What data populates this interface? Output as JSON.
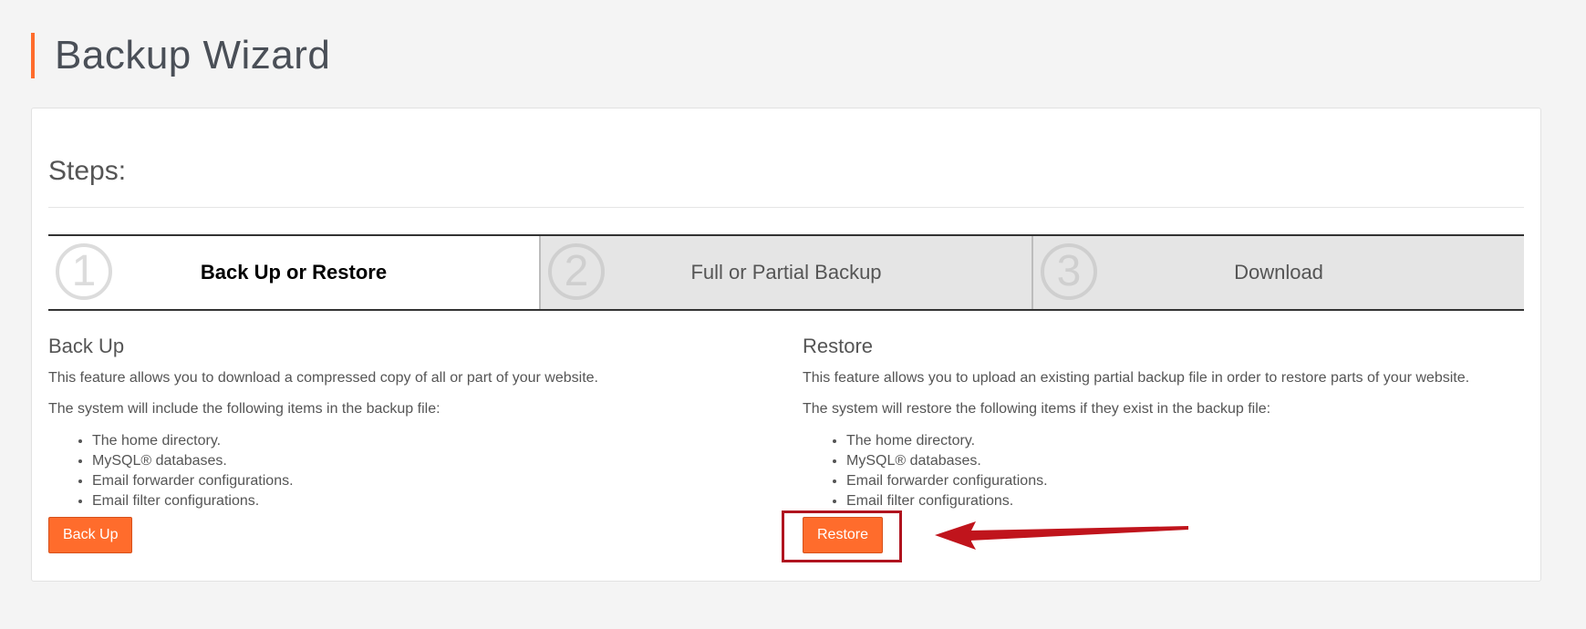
{
  "page": {
    "title": "Backup Wizard"
  },
  "panel": {
    "steps_title": "Steps:"
  },
  "wizard": {
    "steps": [
      {
        "number": "1",
        "label": "Back Up or Restore",
        "state": "active"
      },
      {
        "number": "2",
        "label": "Full or Partial Backup",
        "state": "inactive"
      },
      {
        "number": "3",
        "label": "Download",
        "state": "inactive"
      }
    ]
  },
  "backup": {
    "heading": "Back Up",
    "description": "This feature allows you to download a compressed copy of all or part of your website.",
    "includes_intro": "The system will include the following items in the backup file:",
    "items": [
      "The home directory.",
      "MySQL® databases.",
      "Email forwarder configurations.",
      "Email filter configurations."
    ],
    "button_label": "Back Up"
  },
  "restore": {
    "heading": "Restore",
    "description": "This feature allows you to upload an existing partial backup file in order to restore parts of your website.",
    "includes_intro": "The system will restore the following items if they exist in the backup file:",
    "items": [
      "The home directory.",
      "MySQL® databases.",
      "Email forwarder configurations.",
      "Email filter configurations."
    ],
    "button_label": "Restore"
  },
  "annotation": {
    "highlight_color": "#b0141f",
    "arrow_color": "#c0141c"
  },
  "theme": {
    "accent": "#ff6c2c",
    "background": "#f4f4f4"
  }
}
